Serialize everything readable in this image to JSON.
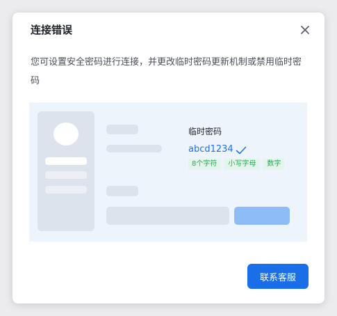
{
  "dialog": {
    "title": "连接错误",
    "description": "您可设置安全密码进行连接，并更改临时密码更新机制或禁用临时密码",
    "close_icon": "close-icon",
    "primary_button": "联系客服"
  },
  "illustration": {
    "password_title": "临时密码",
    "password_value": "abcd1234",
    "check_icon": "check-icon",
    "tags": [
      "8个字符",
      "小写字母",
      "数字"
    ]
  },
  "colors": {
    "accent": "#1a6ee8",
    "tag_green": "#29a858",
    "illustration_bg": "#eef4fb"
  }
}
